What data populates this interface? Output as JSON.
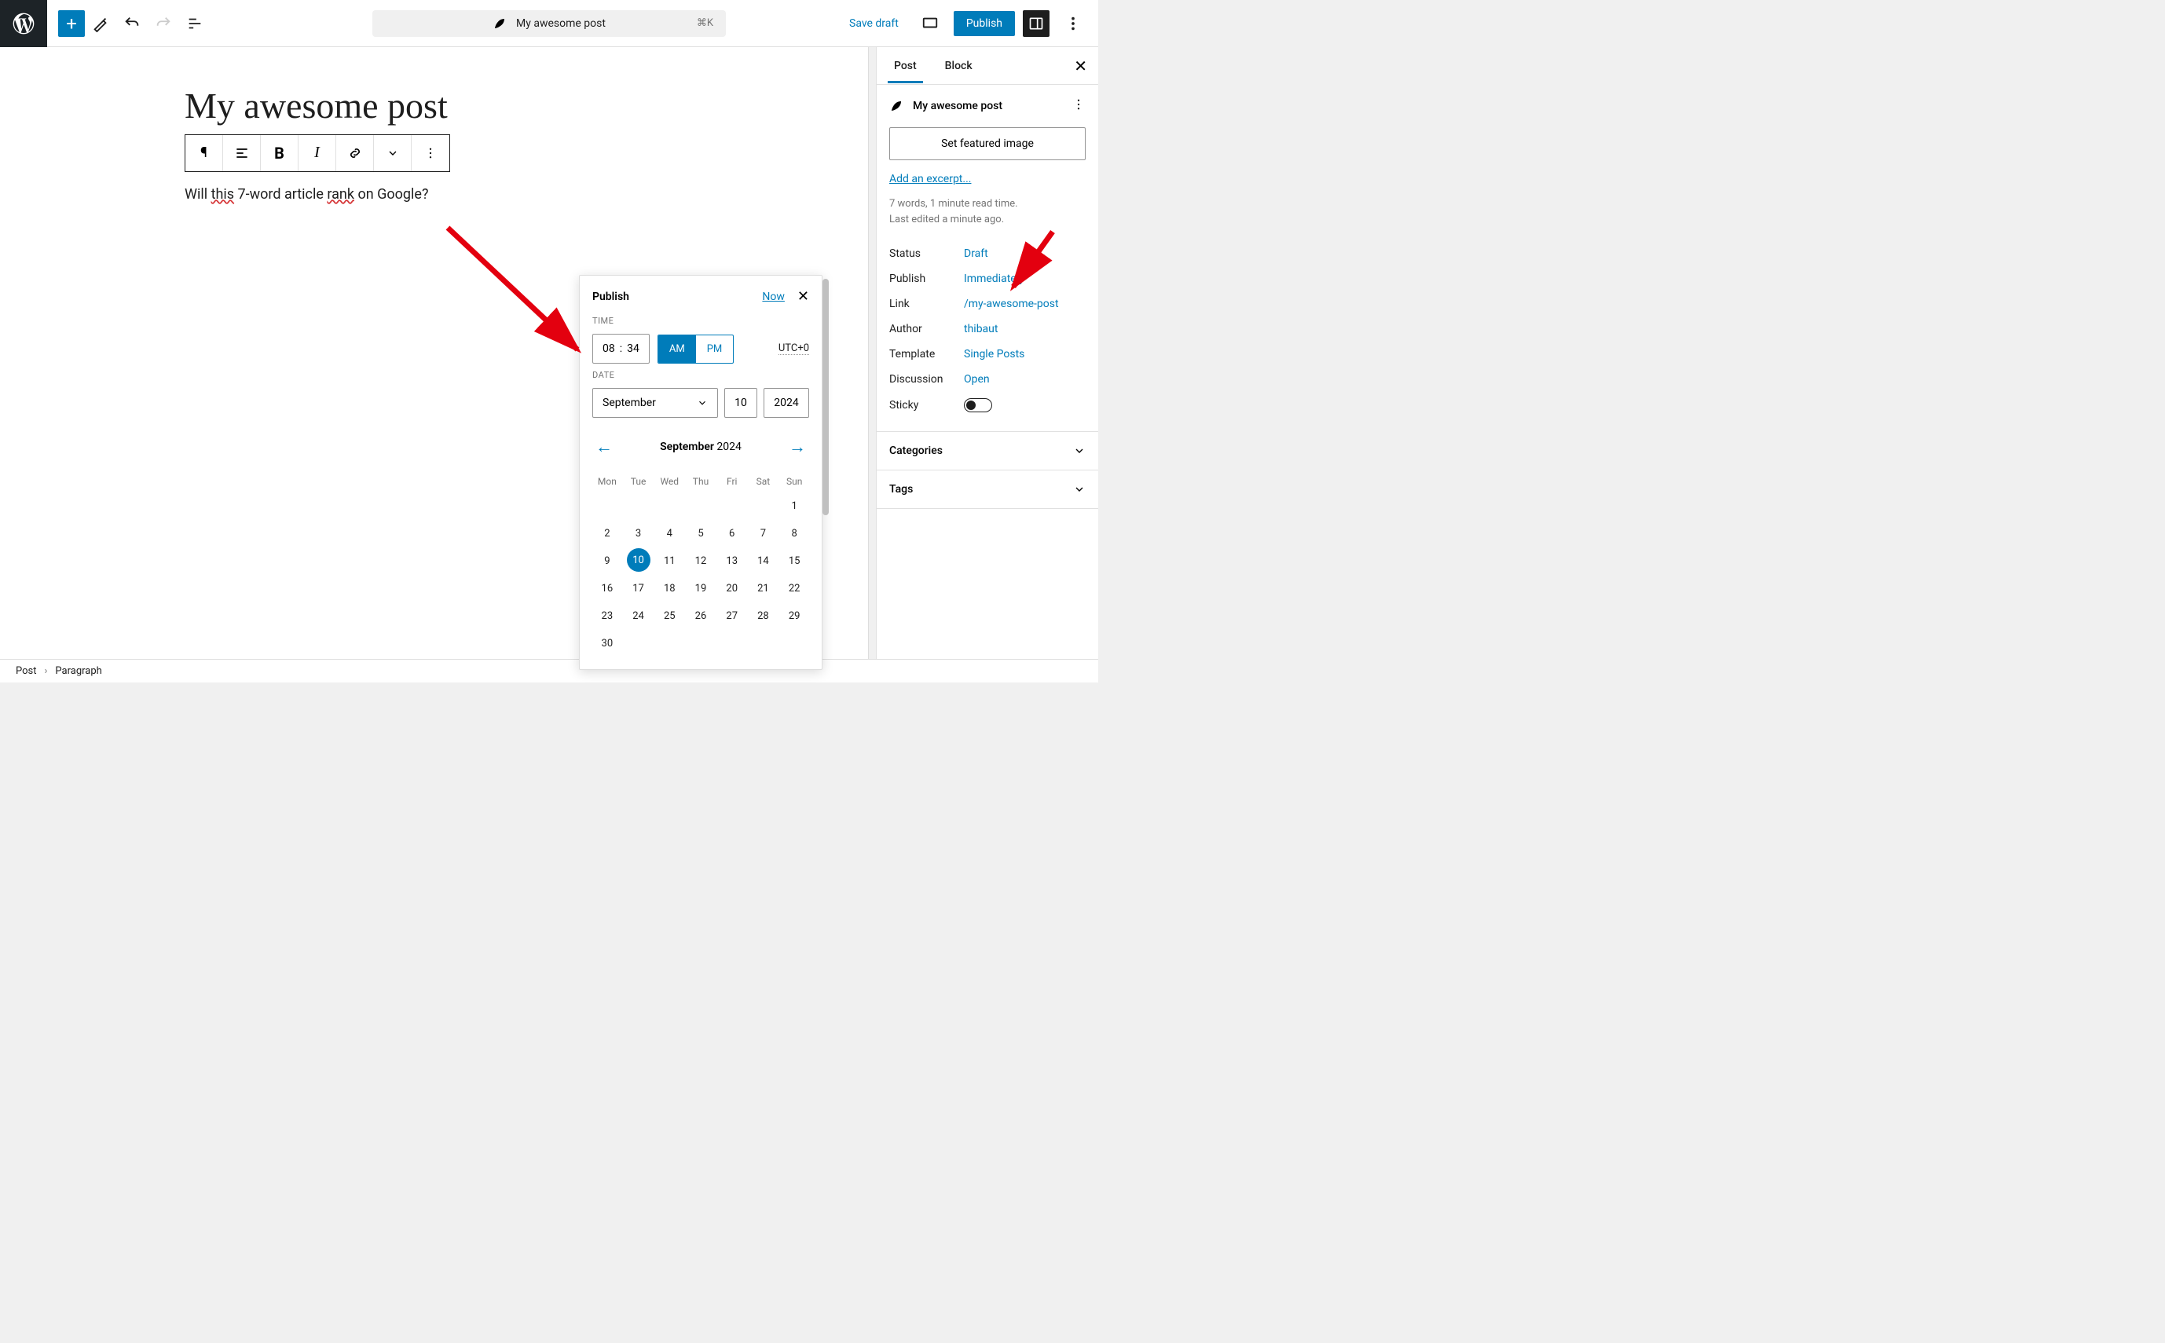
{
  "topbar": {
    "doc_title": "My awesome post",
    "shortcut": "⌘K",
    "save_draft": "Save draft",
    "publish": "Publish"
  },
  "editor": {
    "title": "My awesome post",
    "body_parts": [
      "Will ",
      "this",
      " 7-word article ",
      "rank",
      " on Google?"
    ]
  },
  "popover": {
    "title": "Publish",
    "now": "Now",
    "time_label": "TIME",
    "hour": "08",
    "minute": "34",
    "am": "AM",
    "pm": "PM",
    "tz": "UTC+0",
    "date_label": "DATE",
    "month": "September",
    "day": "10",
    "year": "2024",
    "cal_month": "September",
    "cal_year": "2024",
    "day_headers": [
      "Mon",
      "Tue",
      "Wed",
      "Thu",
      "Fri",
      "Sat",
      "Sun"
    ],
    "weeks": [
      [
        "",
        "",
        "",
        "",
        "",
        "",
        "1"
      ],
      [
        "2",
        "3",
        "4",
        "5",
        "6",
        "7",
        "8"
      ],
      [
        "9",
        "10",
        "11",
        "12",
        "13",
        "14",
        "15"
      ],
      [
        "16",
        "17",
        "18",
        "19",
        "20",
        "21",
        "22"
      ],
      [
        "23",
        "24",
        "25",
        "26",
        "27",
        "28",
        "29"
      ],
      [
        "30",
        "",
        "",
        "",
        "",
        "",
        ""
      ]
    ],
    "selected_day": "10"
  },
  "sidebar": {
    "tabs": {
      "post": "Post",
      "block": "Block"
    },
    "post_title": "My awesome post",
    "featured_image": "Set featured image",
    "excerpt_link": "Add an excerpt...",
    "meta1": "7 words, 1 minute read time.",
    "meta2": "Last edited a minute ago.",
    "rows": [
      {
        "label": "Status",
        "value": "Draft"
      },
      {
        "label": "Publish",
        "value": "Immediately"
      },
      {
        "label": "Link",
        "value": "/my-awesome-post"
      },
      {
        "label": "Author",
        "value": "thibaut"
      },
      {
        "label": "Template",
        "value": "Single Posts"
      },
      {
        "label": "Discussion",
        "value": "Open"
      }
    ],
    "sticky_label": "Sticky",
    "categories": "Categories",
    "tags": "Tags"
  },
  "breadcrumb": {
    "post": "Post",
    "para": "Paragraph"
  }
}
